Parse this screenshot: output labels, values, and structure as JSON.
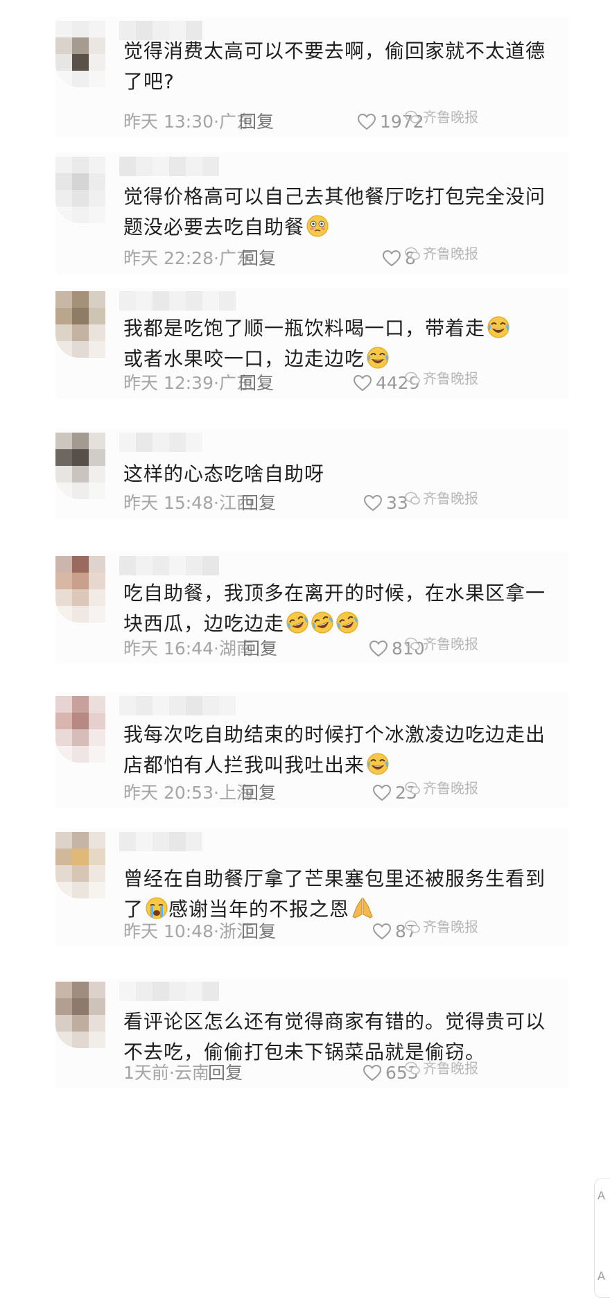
{
  "comments": [
    {
      "text": "觉得消费太高可以不要去啊，偷回家就不太道德了吧?",
      "time": "昨天 13:30",
      "region": "广东",
      "likes": "1972",
      "emojis": []
    },
    {
      "text": "觉得价格高可以自己去其他餐厅吃打包完全没问题没必要去吃自助餐",
      "time": "昨天 22:28",
      "region": "广东",
      "likes": "8",
      "emojis": [
        "flushed"
      ]
    },
    {
      "text": "我都是吃饱了顺一瓶饮料喝一口，带着走",
      "text2": "或者水果咬一口，边走边吃",
      "time": "昨天 12:39",
      "region": "广东",
      "likes": "4429",
      "emojis": [
        "joy"
      ]
    },
    {
      "text": "这样的心态吃啥自助呀",
      "time": "昨天 15:48",
      "region": "江西",
      "likes": "33",
      "emojis": []
    },
    {
      "text": "吃自助餐，我顶多在离开的时候，在水果区拿一块西瓜，边吃边走",
      "time": "昨天 16:44",
      "region": "湖南",
      "likes": "810",
      "emojis": [
        "rofl",
        "rofl",
        "rofl"
      ]
    },
    {
      "text": "我每次吃自助结束的时候打个冰激凌边吃边走出店都怕有人拦我叫我吐出来",
      "time": "昨天 20:53",
      "region": "上海",
      "likes": "23",
      "emojis": [
        "joy"
      ]
    },
    {
      "text": "曾经在自助餐厅拿了芒果塞包里还被服务生看到了",
      "text2": "感谢当年的不报之恩",
      "time": "昨天 10:48",
      "region": "浙江",
      "likes": "87",
      "emojis": [
        "cry",
        "pray"
      ]
    },
    {
      "text": "看评论区怎么还有觉得商家有错的。觉得贵可以不去吃，偷偷打包未下锅菜品就是偷窃。",
      "time": "1天前",
      "region": "云南",
      "likes": "653",
      "emojis": []
    }
  ],
  "labels": {
    "reply": "回复",
    "watermark": "齐鲁晚报",
    "sep": "·"
  },
  "icons": {
    "like": "heart-outline-icon",
    "watermark": "wechat-bubble-icon"
  },
  "colors": {
    "text": "#1f1f1f",
    "meta": "#a5a5a5",
    "reply": "#777777",
    "emoji": "#f7c845"
  },
  "side_tab": {
    "top": "A",
    "bottom": "A"
  }
}
